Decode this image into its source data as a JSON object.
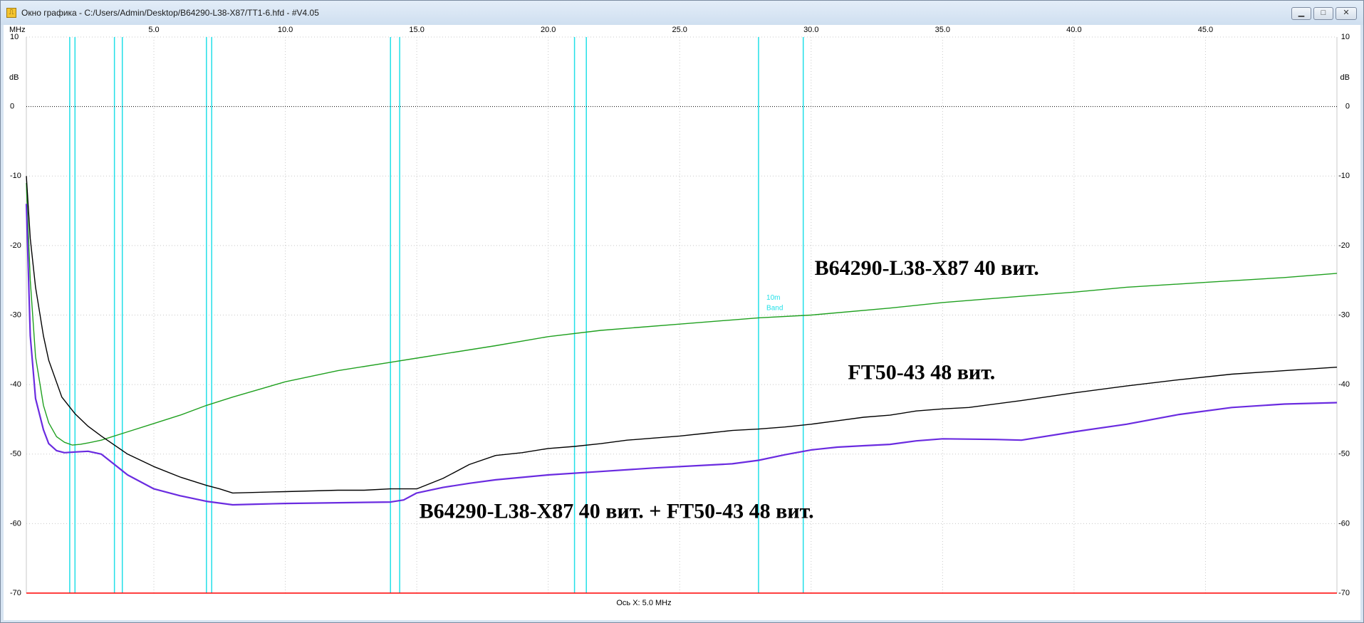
{
  "window": {
    "title": "Окно графика - C:/Users/Admin/Desktop/B64290-L38-X87/TT1-6.hfd -  #V4.05",
    "app_icon": "chart-app-icon",
    "buttons": [
      "minimize",
      "maximize",
      "close"
    ]
  },
  "chart_data": {
    "type": "line",
    "x_unit_label": "MHz",
    "y_unit_label": "dB",
    "x_axis_caption": "Ось X: 5.0 MHz",
    "xlim": [
      0.15,
      50.0
    ],
    "ylim": [
      -70,
      10
    ],
    "x_ticks": [
      5.0,
      10.0,
      15.0,
      20.0,
      25.0,
      30.0,
      35.0,
      40.0,
      45.0
    ],
    "x_tick_labels": [
      "5.0",
      "10.0",
      "15.0",
      "20.0",
      "25.0",
      "30.0",
      "35.0",
      "40.0",
      "45.0"
    ],
    "y_ticks": [
      10,
      0,
      -10,
      -20,
      -30,
      -40,
      -50,
      -60,
      -70
    ],
    "y_tick_labels": [
      "10",
      "0",
      "-10",
      "-20",
      "-30",
      "-40",
      "-50",
      "-60",
      "-70"
    ],
    "grid": true,
    "reference_lines": [
      {
        "y": 0,
        "color": "#000000",
        "style": "dotted"
      },
      {
        "y": -70,
        "color": "#ff0000",
        "style": "solid"
      }
    ],
    "band_edges": [
      1.8,
      2.0,
      3.5,
      3.8,
      7.0,
      7.2,
      14.0,
      14.35,
      21.0,
      21.45,
      28.0,
      29.7
    ],
    "band_color": "#22e0e8",
    "band_labels": [
      {
        "text": "10m",
        "x": 28.3,
        "y": -27.8
      },
      {
        "text": "Band",
        "x": 28.3,
        "y": -29.3
      }
    ],
    "annotations": [
      {
        "text": "B64290-L38-X87 40 вит.",
        "x": 34.4,
        "y": -23.5
      },
      {
        "text": "FT50-43 48 вит.",
        "x": 34.2,
        "y": -38.5
      },
      {
        "text": "B64290-L38-X87 40 вит. + FT50-43 48 вит.",
        "x": 22.6,
        "y": -58.5
      }
    ],
    "series": [
      {
        "color": "#1fa01f",
        "x": [
          0.15,
          0.3,
          0.5,
          0.8,
          1.0,
          1.3,
          1.6,
          1.9,
          2.2,
          2.5,
          3.0,
          4.0,
          5.0,
          6.0,
          7.0,
          8.0,
          10.0,
          12.0,
          15.0,
          18.0,
          20.0,
          22.0,
          25.0,
          28.0,
          30.0,
          33.0,
          35.0,
          38.0,
          40.0,
          42.0,
          45.0,
          48.0,
          50.0
        ],
        "y": [
          -11,
          -25,
          -36,
          -43,
          -45.5,
          -47.5,
          -48.3,
          -48.7,
          -48.6,
          -48.4,
          -48.0,
          -46.8,
          -45.6,
          -44.4,
          -43.0,
          -41.8,
          -39.6,
          -38.0,
          -36.2,
          -34.4,
          -33.1,
          -32.2,
          -31.3,
          -30.4,
          -30.0,
          -29.0,
          -28.2,
          -27.3,
          -26.7,
          -26.0,
          -25.3,
          -24.6,
          -24.0
        ]
      },
      {
        "color": "#000000",
        "x": [
          0.15,
          0.3,
          0.5,
          0.8,
          1.0,
          1.5,
          2.0,
          2.5,
          3.0,
          4.0,
          5.0,
          6.0,
          7.0,
          7.5,
          8.0,
          9.0,
          10.0,
          11.0,
          12.0,
          13.0,
          14.0,
          15.0,
          16.0,
          17.0,
          18.0,
          19.0,
          20.0,
          21.0,
          22.0,
          23.0,
          24.0,
          25.0,
          26.0,
          27.0,
          28.0,
          29.0,
          30.0,
          31.0,
          32.0,
          33.0,
          34.0,
          35.0,
          36.0,
          38.0,
          40.0,
          42.0,
          44.0,
          46.0,
          48.0,
          50.0
        ],
        "y": [
          -10,
          -19,
          -26,
          -33,
          -36.5,
          -41.8,
          -44.2,
          -46.0,
          -47.4,
          -50.0,
          -51.8,
          -53.3,
          -54.5,
          -55.0,
          -55.6,
          -55.5,
          -55.4,
          -55.3,
          -55.2,
          -55.2,
          -55.0,
          -55.0,
          -53.5,
          -51.5,
          -50.2,
          -49.8,
          -49.2,
          -48.9,
          -48.5,
          -48.0,
          -47.7,
          -47.4,
          -47.0,
          -46.6,
          -46.4,
          -46.1,
          -45.7,
          -45.2,
          -44.7,
          -44.4,
          -43.8,
          -43.5,
          -43.3,
          -42.3,
          -41.2,
          -40.2,
          -39.3,
          -38.5,
          -38.0,
          -37.5
        ]
      },
      {
        "color": "#6a2be0",
        "x": [
          0.15,
          0.3,
          0.5,
          0.8,
          1.0,
          1.3,
          1.6,
          2.0,
          2.5,
          3.0,
          3.5,
          4.0,
          5.0,
          6.0,
          7.0,
          8.0,
          9.0,
          10.0,
          12.0,
          14.0,
          14.5,
          15.0,
          16.0,
          17.0,
          18.0,
          20.0,
          22.0,
          24.0,
          26.0,
          27.0,
          28.0,
          29.0,
          30.0,
          31.0,
          32.0,
          33.0,
          34.0,
          35.0,
          37.0,
          38.0,
          40.0,
          42.0,
          44.0,
          46.0,
          48.0,
          50.0
        ],
        "y": [
          -14,
          -33,
          -42,
          -46.5,
          -48.5,
          -49.5,
          -49.8,
          -49.7,
          -49.6,
          -50.0,
          -51.5,
          -53.0,
          -55.0,
          -56.0,
          -56.8,
          -57.3,
          -57.2,
          -57.1,
          -57.0,
          -56.9,
          -56.6,
          -55.6,
          -54.8,
          -54.2,
          -53.7,
          -53.0,
          -52.5,
          -52.0,
          -51.6,
          -51.4,
          -50.9,
          -50.1,
          -49.4,
          -49.0,
          -48.8,
          -48.6,
          -48.1,
          -47.8,
          -47.9,
          -48.0,
          -46.8,
          -45.7,
          -44.3,
          -43.3,
          -42.8,
          -42.6
        ]
      }
    ]
  }
}
